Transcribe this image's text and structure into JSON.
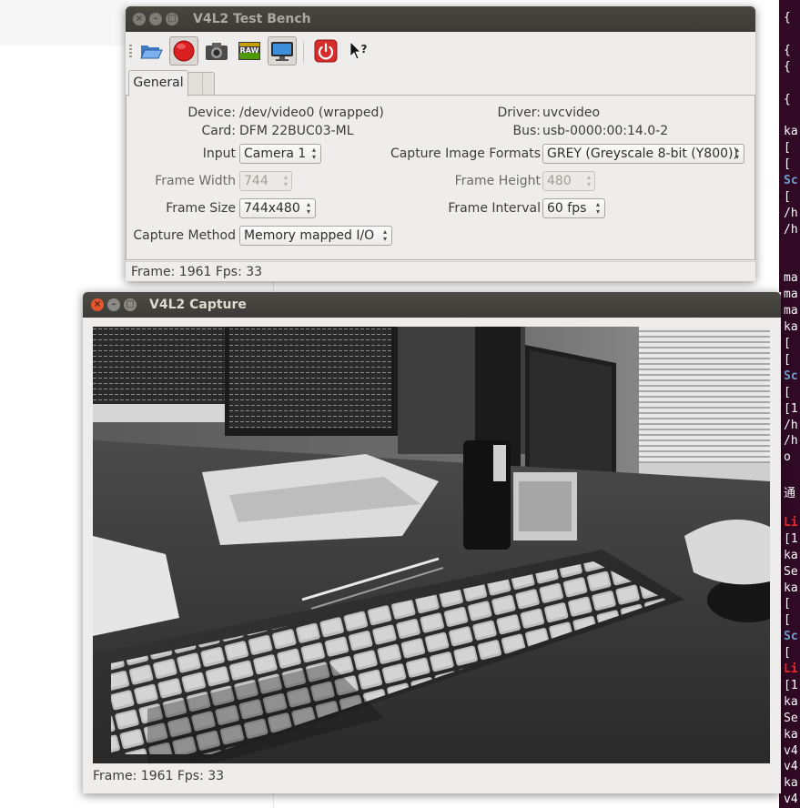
{
  "bench": {
    "title": "V4L2 Test Bench",
    "toolbar_icons": [
      "open-icon",
      "record-icon",
      "camera-icon",
      "raw-icon",
      "display-icon",
      "power-icon",
      "whats-this-icon"
    ],
    "tabs": [
      {
        "label": "General"
      },
      {
        "label": ""
      }
    ],
    "device_label": "Device:",
    "device_value": "/dev/video0 (wrapped)",
    "driver_label": "Driver:",
    "driver_value": "uvcvideo",
    "card_label": "Card:",
    "card_value": "DFM 22BUC03-ML",
    "bus_label": "Bus:",
    "bus_value": "usb-0000:00:14.0-2",
    "input_label": "Input",
    "input_value": "Camera 1",
    "capture_formats_label": "Capture Image Formats",
    "capture_formats_value": "GREY (Greyscale 8-bit (Y800))",
    "frame_width_label": "Frame Width",
    "frame_width_value": "744",
    "frame_height_label": "Frame Height",
    "frame_height_value": "480",
    "frame_size_label": "Frame Size",
    "frame_size_value": "744x480",
    "frame_interval_label": "Frame Interval",
    "frame_interval_value": "60 fps",
    "capture_method_label": "Capture Method",
    "capture_method_value": "Memory mapped I/O",
    "status": "Frame: 1961 Fps: 33"
  },
  "capture": {
    "title": "V4L2 Capture",
    "status": "Frame: 1961 Fps: 33"
  },
  "terminal": {
    "lines": [
      "{",
      "",
      "{",
      "{",
      "",
      "{",
      "",
      "ka",
      "[",
      "[",
      "Sc",
      "[",
      "/h",
      "/h",
      "",
      "",
      "ma",
      "ma",
      "ma",
      "ka",
      "[",
      "[",
      "Sc",
      "[",
      "[1",
      "/h",
      "/h",
      "o",
      "",
      "通",
      "",
      "Li",
      "[1",
      "ka",
      "Se",
      "ka",
      "[",
      "[",
      "Sc",
      "[",
      "Li",
      "[1",
      "ka",
      "Se",
      "ka",
      "v4",
      "v4",
      "ka",
      "v4"
    ]
  },
  "colors": {
    "terminal_bg": "#300a24",
    "terminal_red": "#ef2929",
    "terminal_blue": "#729fcf",
    "title_active": "#3c3b37",
    "window_bg": "#efedeb"
  }
}
